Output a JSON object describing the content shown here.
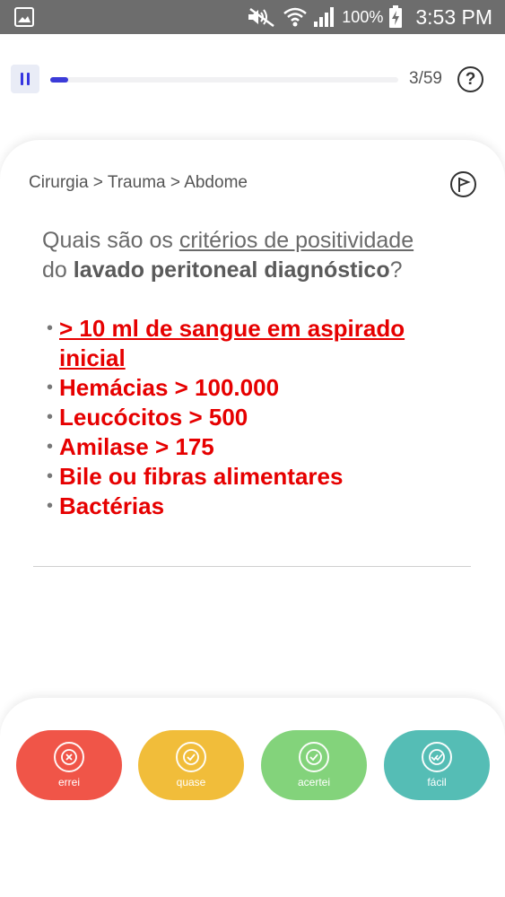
{
  "status_bar": {
    "battery_text": "100%",
    "time": "3:53 PM",
    "icons": [
      "image-icon",
      "mute-icon",
      "wifi-icon",
      "signal-icon",
      "battery-charging-icon"
    ]
  },
  "progress": {
    "counter": "3/59",
    "current": 3,
    "total": 59,
    "accent": "#3b3bd8"
  },
  "card": {
    "breadcrumb": "Cirurgia > Trauma > Abdome",
    "question": {
      "p1": "Quais são os ",
      "p2": "critérios de positividade",
      "p3": " do ",
      "p4": "lavado peritoneal diagnóstico",
      "p5": "?"
    },
    "answers": [
      "> 10 ml de sangue em aspirado inicial",
      "Hemácias > 100.000",
      "Leucócitos > 500",
      "Amilase > 175",
      "Bile ou fibras alimentares",
      "Bactérias"
    ],
    "answer_color": "#e60000"
  },
  "rating": {
    "buttons": [
      {
        "label": "errei",
        "color": "#f05548",
        "icon": "x-circle-icon"
      },
      {
        "label": "quase",
        "color": "#f1bd3a",
        "icon": "almost-check-icon"
      },
      {
        "label": "acertei",
        "color": "#83d37b",
        "icon": "check-icon"
      },
      {
        "label": "fácil",
        "color": "#55bdb5",
        "icon": "double-check-icon"
      }
    ]
  }
}
